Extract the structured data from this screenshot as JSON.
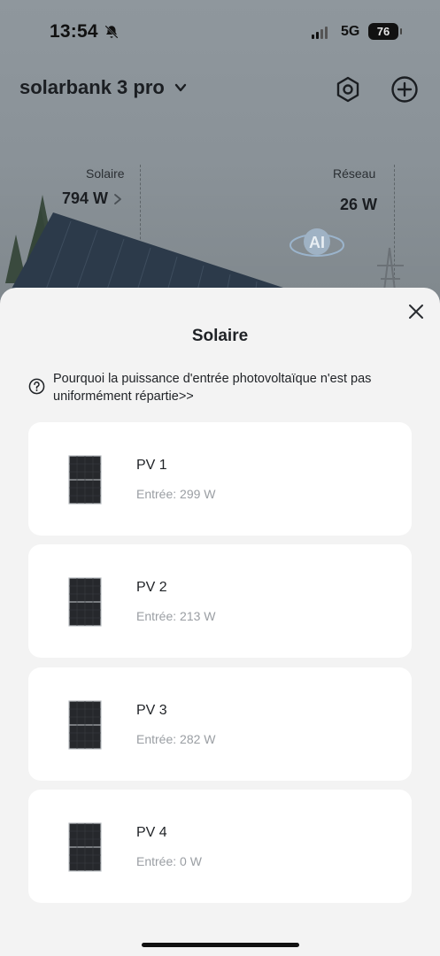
{
  "status_bar": {
    "time": "13:54",
    "network": "5G",
    "battery": "76"
  },
  "header": {
    "device_name": "solarbank 3 pro"
  },
  "flow": {
    "solar_label": "Solaire",
    "solar_value": "794 W",
    "grid_label": "Réseau",
    "grid_value": "26 W",
    "ai_badge": "AI"
  },
  "sheet": {
    "title": "Solaire",
    "help_text": "Pourquoi la puissance d'entrée photovoltaïque n'est pas uniformément répartie>>",
    "panels": [
      {
        "name": "PV 1",
        "input": "Entrée: 299 W"
      },
      {
        "name": "PV 2",
        "input": "Entrée: 213 W"
      },
      {
        "name": "PV 3",
        "input": "Entrée: 282 W"
      },
      {
        "name": "PV 4",
        "input": "Entrée: 0 W"
      }
    ]
  },
  "colors": {
    "overlay_bg": "#8a9298",
    "sheet_bg": "#f3f3f3",
    "card_bg": "#ffffff",
    "text_primary": "#1f2226",
    "text_secondary": "#9a9ea3"
  }
}
